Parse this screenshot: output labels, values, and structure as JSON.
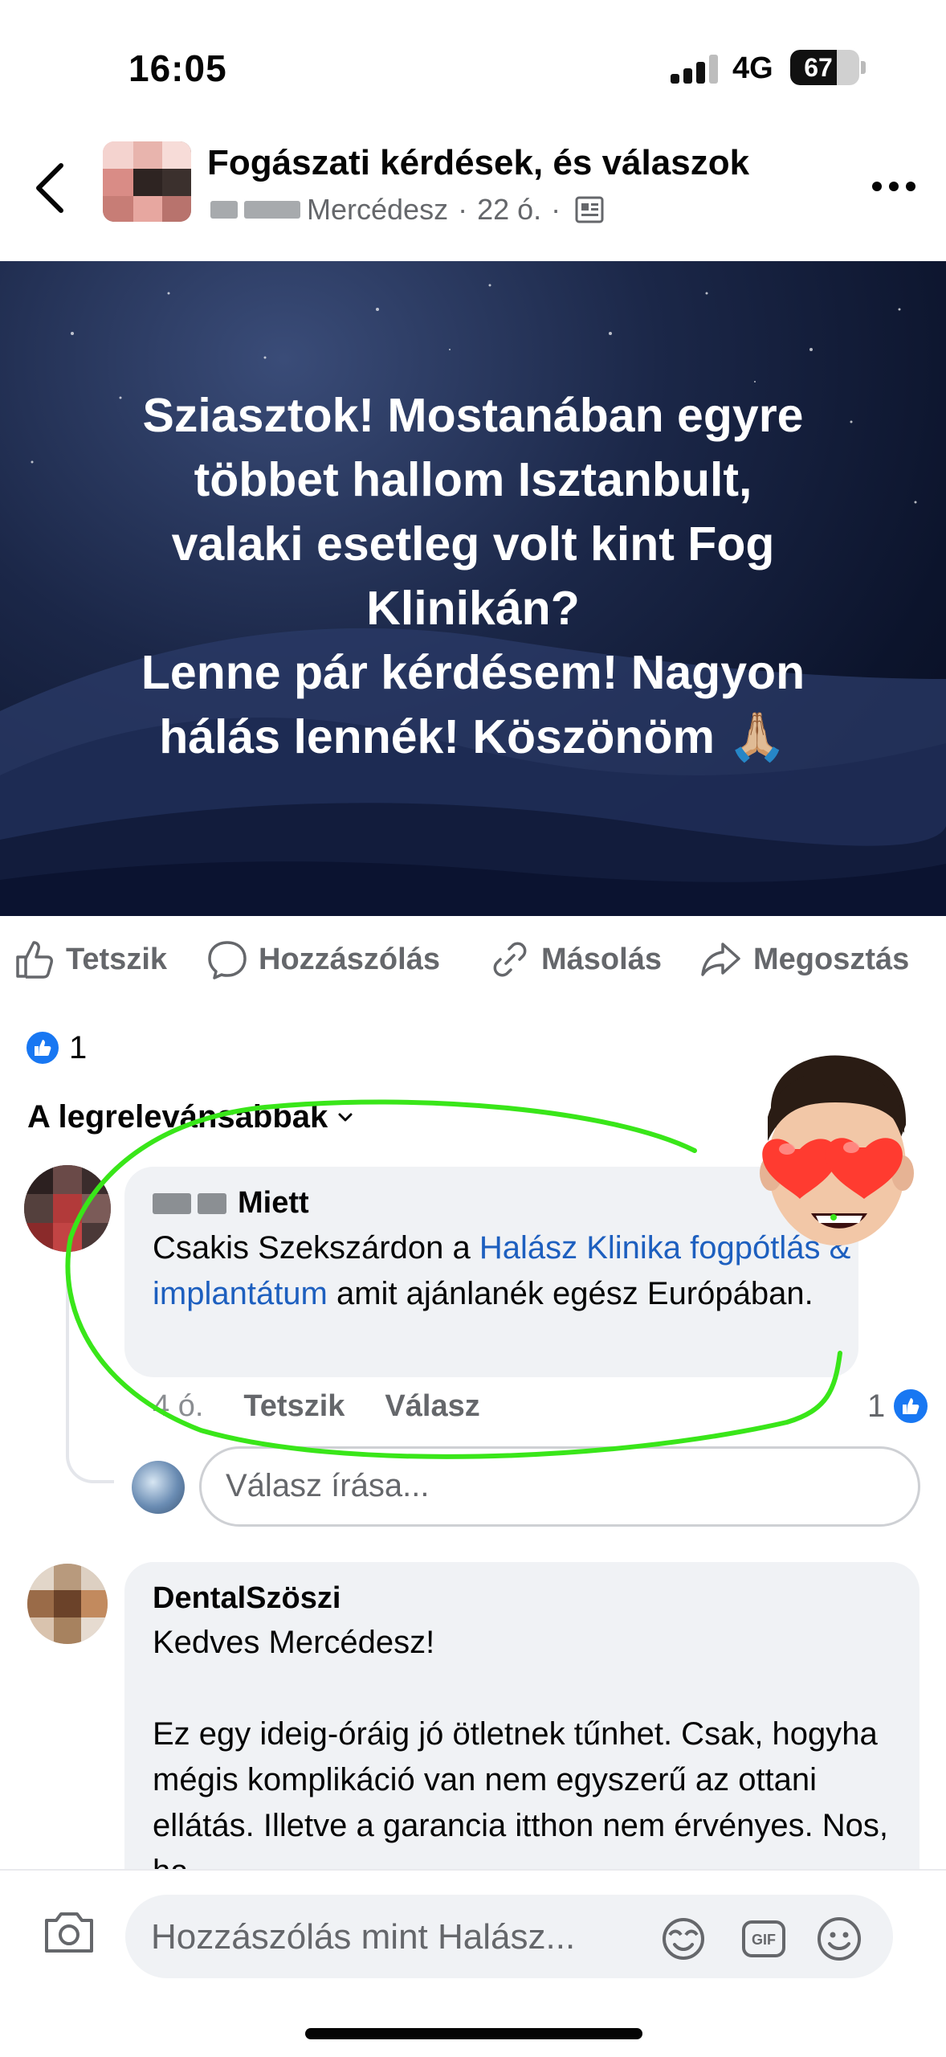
{
  "status_bar": {
    "time": "16:05",
    "network": "4G",
    "battery": "67",
    "battery_level_percent": 67
  },
  "header": {
    "group_name": "Fogászati kérdések, és válaszok",
    "author": "Mercédesz",
    "time": "22 ó.",
    "separator": "·"
  },
  "post": {
    "lines": [
      "Sziasztok! Mostanában egyre",
      "többet hallom Isztanbult,",
      "valaki esetleg volt kint Fog",
      "Klinikán?",
      "Lenne pár kérdésem! Nagyon",
      "hálás lennék! Köszönöm 🙏🏼"
    ]
  },
  "actions": {
    "like": "Tetszik",
    "comment": "Hozzászólás",
    "copy": "Másolás",
    "share": "Megosztás"
  },
  "reactions": {
    "count": "1"
  },
  "sort": {
    "label": "A legrelevánsabbak"
  },
  "comments": [
    {
      "author": "Miett",
      "text_before": "Csakis Szekszárdon a ",
      "link_text": "Halász Klinika fogpótlás & implantátum",
      "text_after": " amit ajánlanék egész Európában.",
      "time": "4 ó.",
      "like_label": "Tetszik",
      "reply_label": "Válasz",
      "like_count": "1"
    },
    {
      "author": "DentalSzöszi",
      "greeting": "Kedves Mercédesz!",
      "body": "Ez egy ideig-óráig jó ötletnek tűnhet. Csak, hogyha mégis komplikáció van nem egyszerű az ottani ellátás. Illetve a garancia itthon nem érvényes. Nos, ha"
    }
  ],
  "reply_box": {
    "placeholder": "Válasz írása..."
  },
  "composer": {
    "placeholder": "Hozzászólás mint Halász..."
  },
  "colors": {
    "link": "#1d5fbf",
    "like_blue": "#1877f2",
    "highlight_green": "#39e619",
    "secondary_text": "#65676b",
    "bubble_bg": "#f0f2f5"
  },
  "icons": [
    "back-icon",
    "more-icon",
    "page-icon",
    "like-icon",
    "comment-icon",
    "link-icon",
    "share-icon",
    "chevron-down-icon",
    "camera-icon",
    "avatar-sticker-icon",
    "gif-icon",
    "emoji-icon"
  ]
}
